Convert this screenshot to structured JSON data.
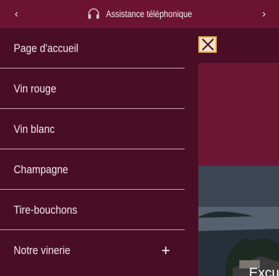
{
  "topbar": {
    "prev_icon": "chevron-left-icon",
    "next_icon": "chevron-right-icon",
    "support_icon": "headset-icon",
    "label": "Assistance téléphonique"
  },
  "menu": {
    "items": [
      {
        "label": "Page d'accueil"
      },
      {
        "label": "Vin rouge"
      },
      {
        "label": "Vin blanc"
      },
      {
        "label": "Champagne"
      },
      {
        "label": "Tire-bouchons"
      },
      {
        "label": "Notre vinerie",
        "expand_icon": "plus-icon"
      }
    ]
  },
  "background": {
    "close_icon": "close-icon",
    "caption": "Excu"
  },
  "colors": {
    "topbar": "#6b1330",
    "drawer": "#4a0d26",
    "hero": "#6f1534",
    "accent": "#e6b34a"
  }
}
